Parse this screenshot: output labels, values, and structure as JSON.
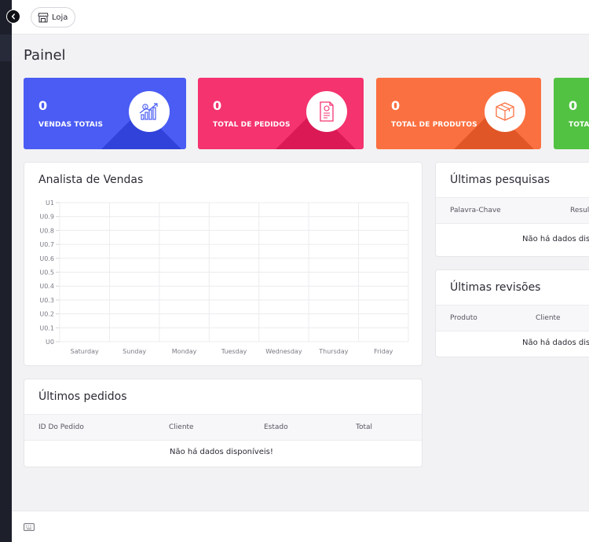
{
  "topbar": {
    "store_label": "Loja"
  },
  "page": {
    "title": "Painel"
  },
  "stats": [
    {
      "count": "0",
      "label": "VENDAS TOTAIS",
      "color": "#4a5cf4",
      "icon": "chart-growth-icon"
    },
    {
      "count": "0",
      "label": "TOTAL DE PEDIDOS",
      "color": "#f4336f",
      "icon": "invoice-icon"
    },
    {
      "count": "0",
      "label": "TOTAL DE PRODUTOS",
      "color": "#fb7040",
      "icon": "box-icon"
    },
    {
      "count": "0",
      "label": "TOTA",
      "color": "#52c242",
      "icon": "users-icon"
    }
  ],
  "sales_chart": {
    "title": "Analista de Vendas",
    "chart_data": {
      "type": "line",
      "categories": [
        "Saturday",
        "Sunday",
        "Monday",
        "Tuesday",
        "Wednesday",
        "Thursday",
        "Friday"
      ],
      "y_ticks": [
        "U1",
        "U0.9",
        "U0.8",
        "U0.7",
        "U0.6",
        "U0.5",
        "U0.4",
        "U0.3",
        "U0.2",
        "U0.1",
        "U0"
      ],
      "ylim": [
        0,
        1
      ],
      "grid": true,
      "series": []
    }
  },
  "recent_searches": {
    "title": "Últimas pesquisas",
    "columns": [
      "Palavra-Chave",
      "Resul"
    ],
    "empty": "Não há dados dis"
  },
  "recent_reviews": {
    "title": "Últimas revisões",
    "columns": [
      "Produto",
      "Cliente"
    ],
    "empty": "Não há dados dis"
  },
  "recent_orders": {
    "title": "Últimos pedidos",
    "columns": [
      "ID Do Pedido",
      "Cliente",
      "Estado",
      "Total"
    ],
    "empty": "Não há dados disponíveis!"
  },
  "footer": {
    "icon": "keyboard-icon"
  }
}
